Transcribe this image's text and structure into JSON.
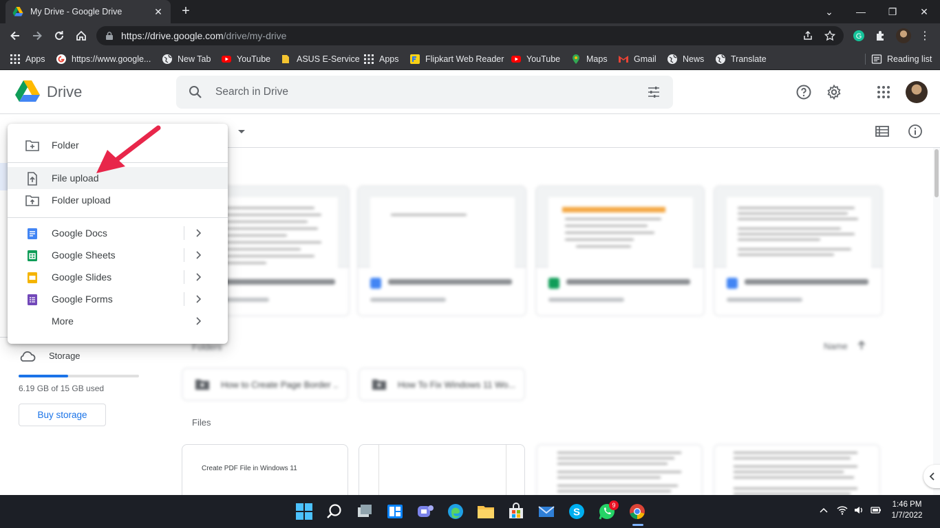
{
  "browser": {
    "tab_title": "My Drive - Google Drive",
    "url_host": "https://drive.google.com",
    "url_path": "/drive/my-drive",
    "bookmarks": [
      "Apps",
      "https://www.google...",
      "New Tab",
      "YouTube",
      "ASUS E-Service",
      "Apps",
      "Flipkart Web Reader",
      "YouTube",
      "Maps",
      "Gmail",
      "News",
      "Translate"
    ],
    "reading_list": "Reading list"
  },
  "drive": {
    "brand": "Drive",
    "search_placeholder": "Search in Drive"
  },
  "new_menu": {
    "items": [
      {
        "label": "Folder",
        "icon": "new-folder-icon"
      },
      {
        "label": "File upload",
        "icon": "file-upload-icon"
      },
      {
        "label": "Folder upload",
        "icon": "folder-upload-icon"
      },
      {
        "label": "Google Docs",
        "icon": "google-docs-icon"
      },
      {
        "label": "Google Sheets",
        "icon": "google-sheets-icon"
      },
      {
        "label": "Google Slides",
        "icon": "google-slides-icon"
      },
      {
        "label": "Google Forms",
        "icon": "google-forms-icon"
      },
      {
        "label": "More",
        "icon": ""
      }
    ],
    "hovered": "File upload"
  },
  "sidebar": {
    "storage_label": "Storage",
    "storage_used_text": "6.19 GB of 15 GB used",
    "storage_fraction": 0.41,
    "buy_storage": "Buy storage"
  },
  "main": {
    "folders_label": "Folders",
    "sort_label": "Name",
    "files_label": "Files",
    "folder_items": [
      "How to Create Page Border ...",
      "How To Fix Windows 11 Wo..."
    ],
    "file_preview_text": "Create PDF File in Windows 11"
  },
  "taskbar": {
    "time": "1:46 PM",
    "date": "1/7/2022",
    "whatsapp_badge": "9"
  },
  "colors": {
    "accent": "#1a73e8",
    "arrow": "#e8264a",
    "chrome_dark": "#202124"
  }
}
